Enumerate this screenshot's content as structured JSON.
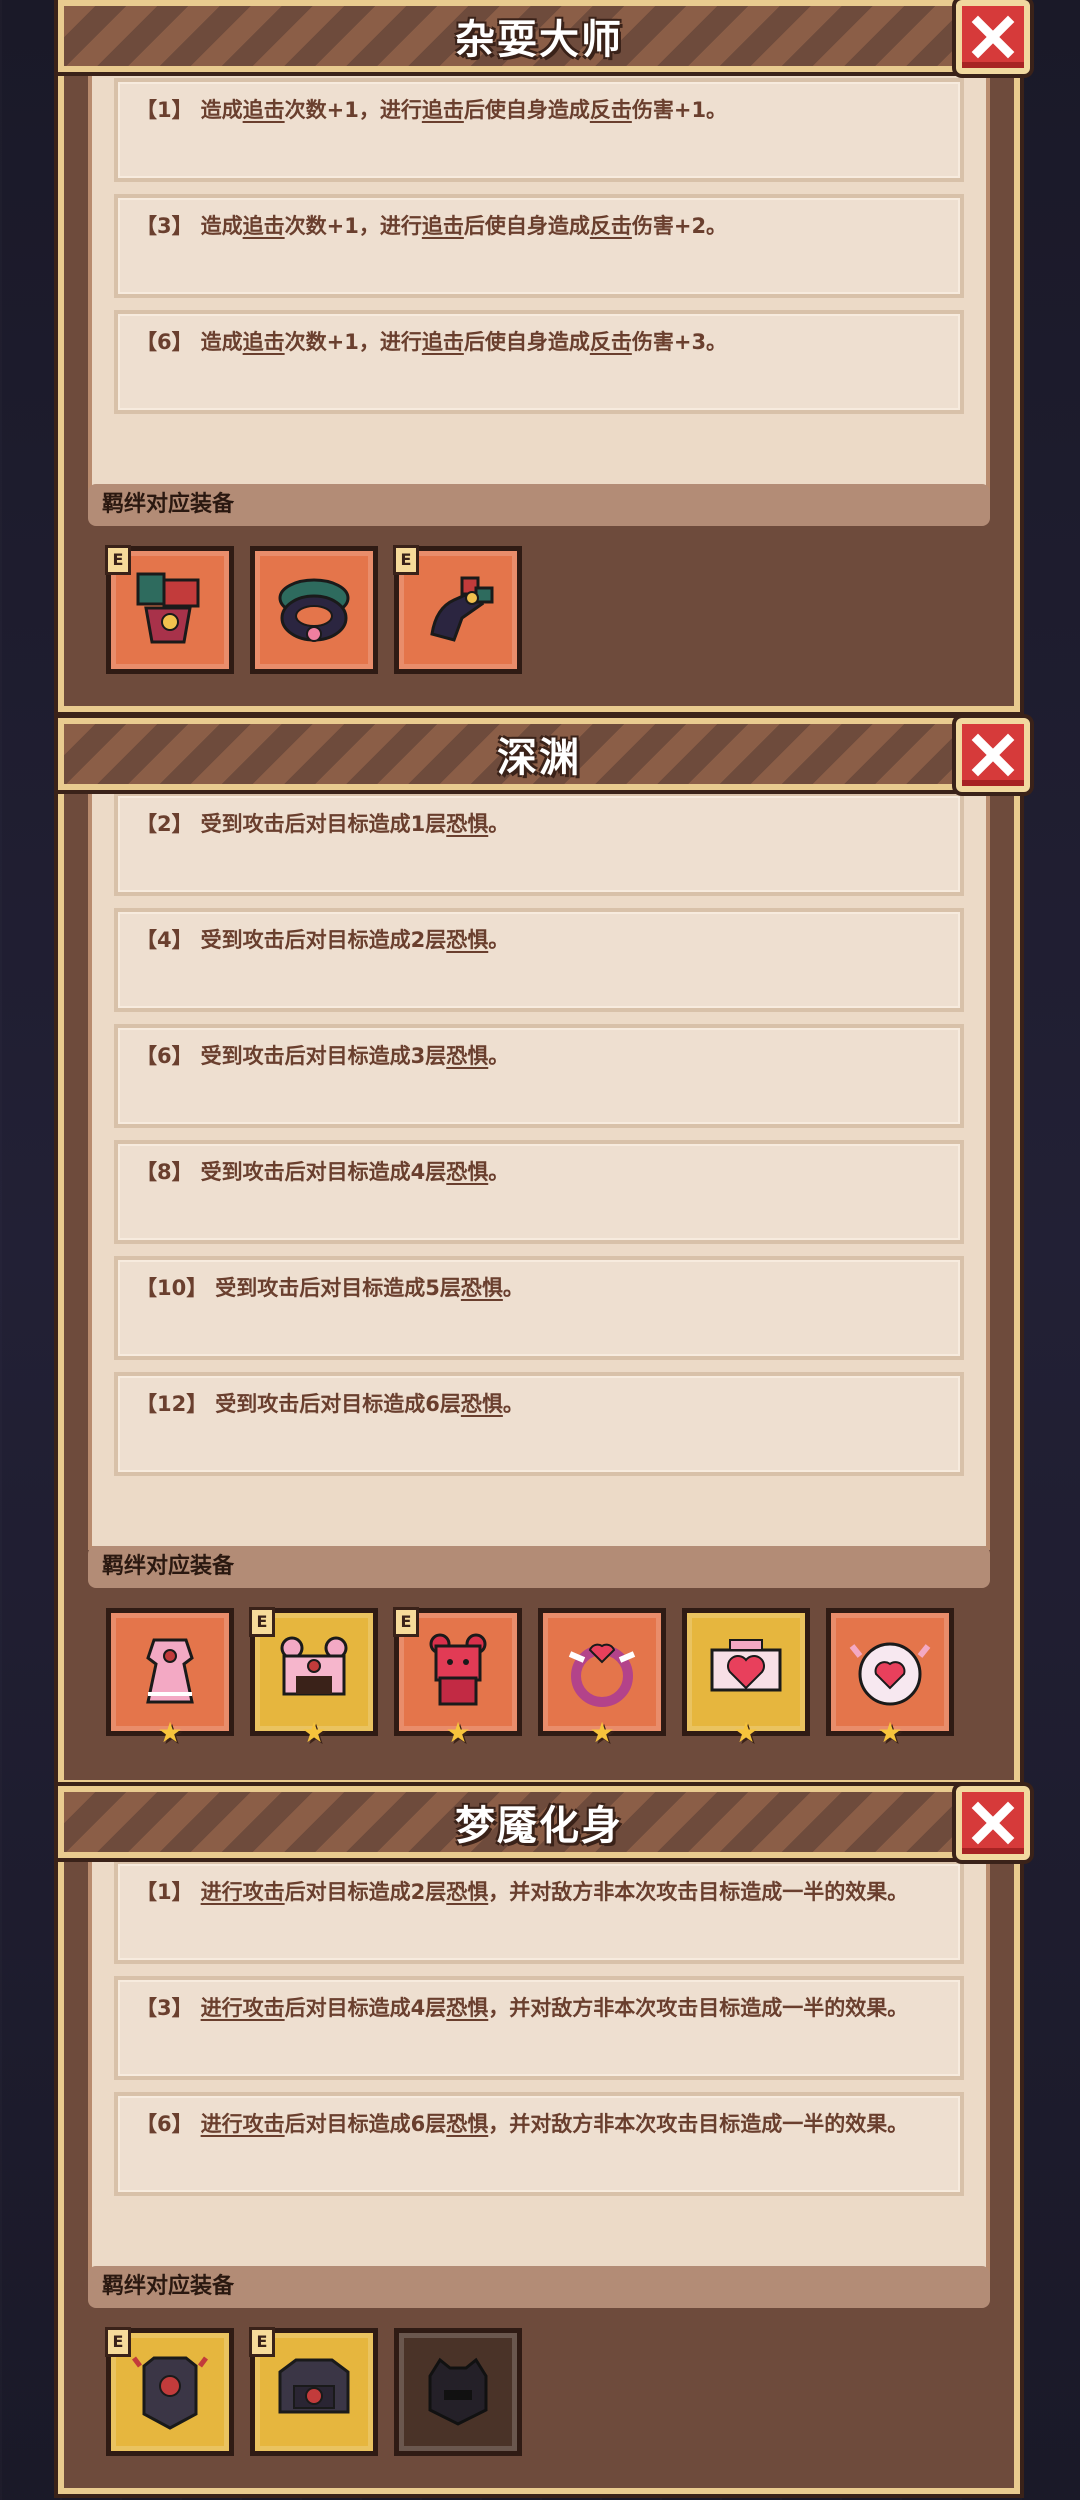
{
  "panels": [
    {
      "title": "杂耍大师",
      "equip_label": "羁绊对应装备",
      "effects": [
        {
          "level": "【1】",
          "parts": [
            "造成",
            "追击",
            "次数+1，进行",
            "追击",
            "后使自身造成",
            "反击",
            "伤害+1。"
          ]
        },
        {
          "level": "【3】",
          "parts": [
            "造成",
            "追击",
            "次数+1，进行",
            "追击",
            "后使自身造成",
            "反击",
            "伤害+2。"
          ]
        },
        {
          "level": "【6】",
          "parts": [
            "造成",
            "追击",
            "次数+1，进行",
            "追击",
            "后使自身造成",
            "反击",
            "伤害+3。"
          ]
        }
      ],
      "equipment": [
        {
          "icon": "jester-armor-icon",
          "slot": "orange",
          "badge": "E",
          "star": false
        },
        {
          "icon": "jester-collar-icon",
          "slot": "orange",
          "badge": "",
          "star": false
        },
        {
          "icon": "jester-shoe-icon",
          "slot": "orange",
          "badge": "E",
          "star": false
        }
      ]
    },
    {
      "title": "深渊",
      "equip_label": "羁绊对应装备",
      "effects": [
        {
          "level": "【2】",
          "parts": [
            "受到攻击后对目标造成1层",
            "恐惧",
            "。"
          ]
        },
        {
          "level": "【4】",
          "parts": [
            "受到攻击后对目标造成2层",
            "恐惧",
            "。"
          ]
        },
        {
          "level": "【6】",
          "parts": [
            "受到攻击后对目标造成3层",
            "恐惧",
            "。"
          ]
        },
        {
          "level": "【8】",
          "parts": [
            "受到攻击后对目标造成4层",
            "恐惧",
            "。"
          ]
        },
        {
          "level": "【10】",
          "parts": [
            "受到攻击后对目标造成5层",
            "恐惧",
            "。"
          ]
        },
        {
          "level": "【12】",
          "parts": [
            "受到攻击后对目标造成6层",
            "恐惧",
            "。"
          ]
        }
      ],
      "equipment": [
        {
          "icon": "pink-dress-icon",
          "slot": "orange",
          "badge": "",
          "star": true
        },
        {
          "icon": "bear-hood-icon",
          "slot": "gold",
          "badge": "E",
          "star": true
        },
        {
          "icon": "red-bear-icon",
          "slot": "orange",
          "badge": "E",
          "star": true
        },
        {
          "icon": "heart-ring-icon",
          "slot": "orange",
          "badge": "",
          "star": true
        },
        {
          "icon": "heart-frame-icon",
          "slot": "gold",
          "badge": "",
          "star": true
        },
        {
          "icon": "heart-shield-icon",
          "slot": "orange",
          "badge": "",
          "star": true
        }
      ]
    },
    {
      "title": "梦魇化身",
      "equip_label": "羁绊对应装备",
      "effects": [
        {
          "level": "【1】",
          "parts": [
            "进行攻击",
            "后对目标造成2层",
            "恐惧",
            "，并对敌方非本次攻击目标造成一半的效果。"
          ]
        },
        {
          "level": "【3】",
          "parts": [
            "进行攻击",
            "后对目标造成4层",
            "恐惧",
            "，并对敌方非本次攻击目标造成一半的效果。"
          ]
        },
        {
          "level": "【6】",
          "parts": [
            "进行攻击",
            "后对目标造成6层",
            "恐惧",
            "，并对敌方非本次攻击目标造成一半的效果。"
          ]
        }
      ],
      "equipment": [
        {
          "icon": "nightmare-armor-icon",
          "slot": "gold",
          "badge": "E",
          "star": false
        },
        {
          "icon": "nightmare-chest-icon",
          "slot": "gold",
          "badge": "E",
          "star": false
        },
        {
          "icon": "nightmare-helm-icon",
          "slot": "dark",
          "badge": "",
          "star": false
        }
      ]
    }
  ],
  "colors": {
    "panel_bg": "#6e4b3c",
    "panel_border": "#e9cb8f",
    "effects_bg": "#ecdac7",
    "effect_text": "#6a3f2e",
    "close_red": "#d63a3a",
    "slot_orange": "#e4754b",
    "slot_gold": "#e6b63e",
    "slot_dark": "#4a3328"
  }
}
